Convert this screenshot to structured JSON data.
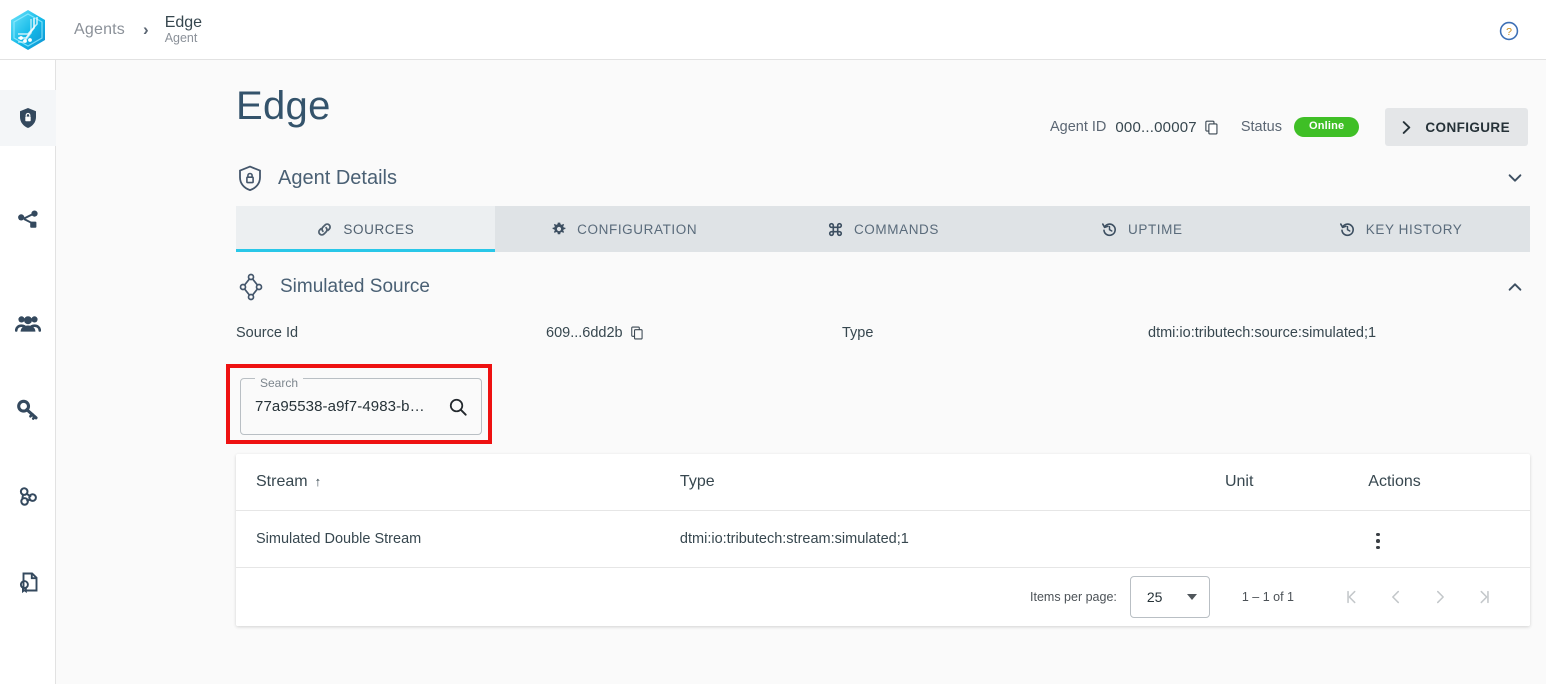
{
  "app": {
    "logo_name": "tributech-hexagon-logo",
    "help_icon": "help-circle-icon"
  },
  "breadcrumb": {
    "root": "Agents",
    "separator": "›",
    "current_title": "Edge",
    "current_subtitle": "Agent"
  },
  "sidebar": {
    "items": [
      {
        "icon": "shield-lock-icon",
        "active": true
      },
      {
        "icon": "share-nodes-icon",
        "active": false
      },
      {
        "icon": "users-group-icon",
        "active": false
      },
      {
        "icon": "key-icon",
        "active": false
      },
      {
        "icon": "webhook-icon",
        "active": false
      },
      {
        "icon": "certificate-document-icon",
        "active": false
      }
    ]
  },
  "page": {
    "title": "Edge",
    "agent_id_label": "Agent ID",
    "agent_id_value": "000...00007",
    "copy_icon": "copy-icon",
    "status_label": "Status",
    "status_value": "Online",
    "status_color": "#3fbf26",
    "configure_label": "CONFIGURE",
    "configure_chevron": "chevron-right-icon"
  },
  "agent_details": {
    "title": "Agent Details",
    "icon": "shield-lock-outline-icon",
    "collapse_icon": "chevron-down-icon"
  },
  "tabs": [
    {
      "label": "SOURCES",
      "icon": "link-icon",
      "active": true
    },
    {
      "label": "CONFIGURATION",
      "icon": "gear-icon",
      "active": false
    },
    {
      "label": "COMMANDS",
      "icon": "command-icon",
      "active": false
    },
    {
      "label": "UPTIME",
      "icon": "history-icon",
      "active": false
    },
    {
      "label": "KEY HISTORY",
      "icon": "history-icon",
      "active": false
    }
  ],
  "source": {
    "title": "Simulated Source",
    "icon": "node-diamond-icon",
    "collapse_icon": "chevron-up-icon",
    "source_id_label": "Source Id",
    "source_id_value": "609...6dd2b",
    "copy_icon": "copy-icon",
    "type_label": "Type",
    "type_value": "dtmi:io:tributech:source:simulated;1"
  },
  "search": {
    "legend": "Search",
    "value": "77a95538-a9f7-4983-b…",
    "placeholder": "Search",
    "icon": "search-icon",
    "highlight_color": "#ee1111"
  },
  "table": {
    "columns": [
      "Stream",
      "Type",
      "Unit",
      "Actions"
    ],
    "sort_column": "Stream",
    "sort_direction": "↑",
    "rows": [
      {
        "stream": "Simulated Double Stream",
        "type": "dtmi:io:tributech:stream:simulated;1",
        "unit": "",
        "actions_icon": "kebab-menu-icon"
      }
    ]
  },
  "paginator": {
    "items_per_page_label": "Items per page:",
    "items_per_page_value": "25",
    "range_label": "1 – 1 of 1",
    "first_icon": "first-page-icon",
    "prev_icon": "previous-page-icon",
    "next_icon": "next-page-icon",
    "last_icon": "last-page-icon"
  }
}
